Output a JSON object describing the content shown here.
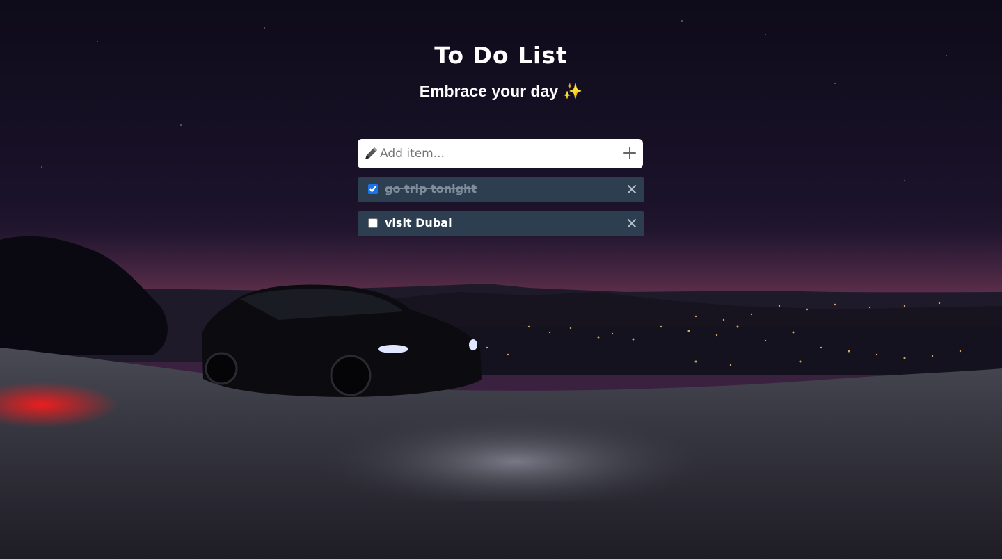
{
  "header": {
    "title": "To Do List",
    "subtitle": "Embrace your day ✨"
  },
  "add_item": {
    "placeholder": "Add item...",
    "value": "",
    "leading_icon": "pencil-icon",
    "add_icon": "plus-icon"
  },
  "todos": [
    {
      "text": "go trip tonight",
      "done": true
    },
    {
      "text": "visit Dubai",
      "done": false
    }
  ],
  "colors": {
    "item_background": "#2c3e50",
    "done_text": "#7f8c9a",
    "text": "#ffffff",
    "checkbox_accent": "#1a73e8"
  },
  "background": {
    "description_icon": "night-scene-with-car"
  }
}
